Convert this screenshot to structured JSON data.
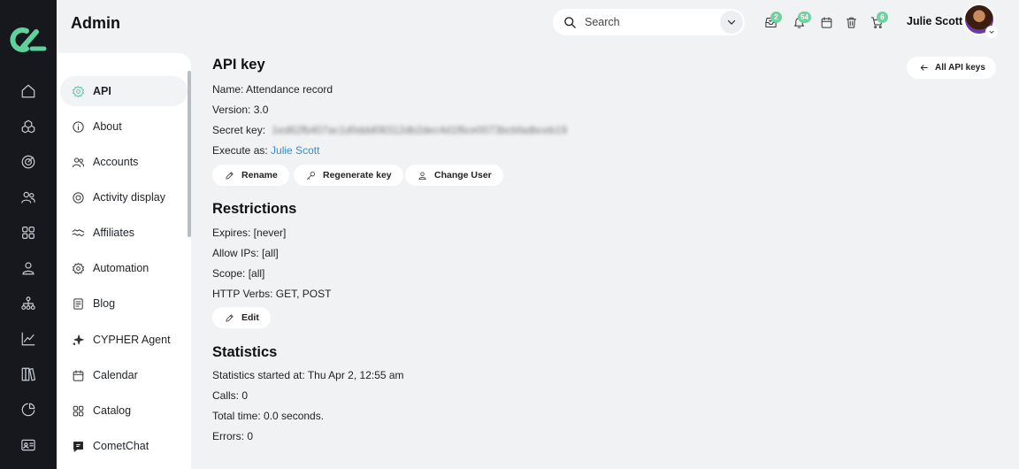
{
  "app": {
    "title": "Admin",
    "accent": "#5fbf9b",
    "link_color": "#2f8fd8"
  },
  "rail": {
    "icons": [
      "home-icon",
      "cubes-icon",
      "target-icon",
      "users-icon",
      "grid-icon",
      "user-icon",
      "sitemap-icon",
      "chart-line-icon",
      "books-icon",
      "pie-chart-icon",
      "id-card-icon"
    ]
  },
  "header": {
    "search_placeholder": "Search",
    "badges": {
      "inbox": "2",
      "notifications": "54",
      "cart": "6"
    },
    "user_name": "Julie Scott"
  },
  "menu": {
    "items": [
      {
        "label": "API",
        "icon": "gear-icon"
      },
      {
        "label": "About",
        "icon": "info-icon"
      },
      {
        "label": "Accounts",
        "icon": "users-icon"
      },
      {
        "label": "Activity display",
        "icon": "target-icon"
      },
      {
        "label": "Affiliates",
        "icon": "handshake-icon"
      },
      {
        "label": "Automation",
        "icon": "gear-icon"
      },
      {
        "label": "Blog",
        "icon": "document-icon"
      },
      {
        "label": "CYPHER Agent",
        "icon": "sparkle-icon"
      },
      {
        "label": "Calendar",
        "icon": "calendar-icon"
      },
      {
        "label": "Catalog",
        "icon": "grid-icon"
      },
      {
        "label": "CometChat",
        "icon": "chat-icon"
      }
    ]
  },
  "api": {
    "heading": "API key",
    "back_button": "All API keys",
    "name_label": "Name:",
    "name_value": "Attendance record",
    "version_label": "Version:",
    "version_value": "3.0",
    "secret_label": "Secret key:",
    "secret_value": "1ed62fb407ac1d0ddd08312db2dec4d1f6ce0073bcbfadbceb19",
    "execute_label": "Execute as:",
    "execute_value": "Julie Scott",
    "rename_button": "Rename",
    "regenerate_button": "Regenerate key",
    "change_user_button": "Change User"
  },
  "restrictions": {
    "heading": "Restrictions",
    "expires": "Expires: [never]",
    "allow_ips": "Allow IPs: [all]",
    "scope": "Scope: [all]",
    "http_verbs": "HTTP Verbs: GET, POST",
    "edit_button": "Edit"
  },
  "statistics": {
    "heading": "Statistics",
    "started": "Statistics started at: Thu Apr 2, 12:55 am",
    "calls": "Calls: 0",
    "total_time": "Total time: 0.0 seconds.",
    "errors": "Errors: 0"
  }
}
